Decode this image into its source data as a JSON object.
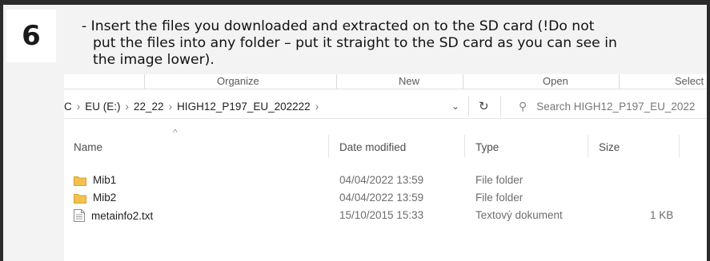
{
  "step": {
    "number": "6"
  },
  "instruction": {
    "lines": [
      "-  Insert the files you downloaded and extracted on to the SD card (!Do not",
      "put the files into any folder – put it straight to the SD card as you can see in",
      "the image lower)."
    ]
  },
  "explorer": {
    "ribbon": {
      "organize": "Organize",
      "new": "New",
      "open": "Open",
      "select": "Select"
    },
    "address": {
      "crumbs": [
        "C",
        "EU (E:)",
        "22_22",
        "HIGH12_P197_EU_202222"
      ],
      "search_placeholder": "Search HIGH12_P197_EU_2022"
    },
    "columns": {
      "name": "Name",
      "date": "Date modified",
      "type": "Type",
      "size": "Size"
    },
    "files": [
      {
        "name": "Mib1",
        "date": "04/04/2022 13:59",
        "type": "File folder",
        "size": "",
        "icon": "folder-icon"
      },
      {
        "name": "Mib2",
        "date": "04/04/2022 13:59",
        "type": "File folder",
        "size": "",
        "icon": "folder-icon"
      },
      {
        "name": "metainfo2.txt",
        "date": "15/10/2015 15:33",
        "type": "Textový dokument",
        "size": "1 KB",
        "icon": "text-file-icon"
      }
    ]
  },
  "colors": {
    "frame": "#2b2b2b",
    "panel": "#f3f3f3",
    "folder": "#f2c14e"
  }
}
